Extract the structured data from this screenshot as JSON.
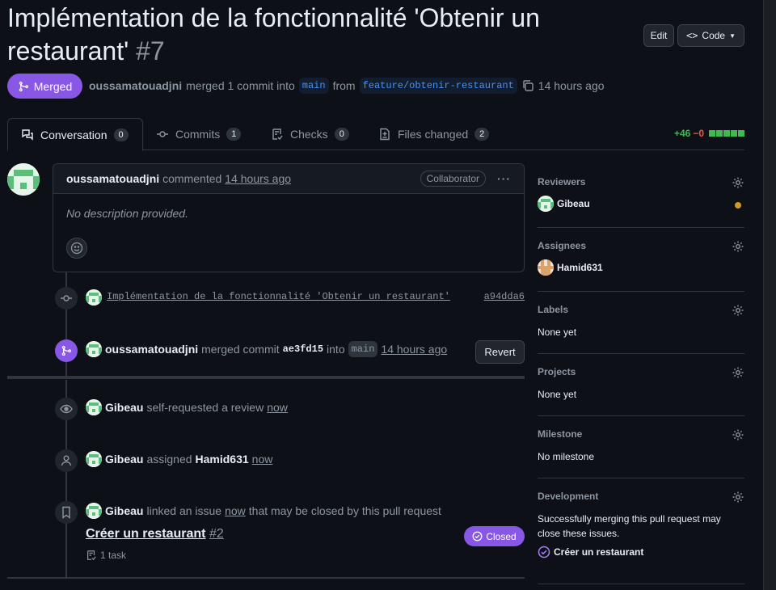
{
  "header": {
    "title": "Implémentation de la fonctionnalité 'Obtenir un restaurant'",
    "number": "#7",
    "edit_label": "Edit",
    "code_label": "Code"
  },
  "status": {
    "state_label": "Merged",
    "author": "oussamatouadjni",
    "merged_text": "merged 1 commit into",
    "base_branch": "main",
    "from_text": "from",
    "head_branch": "feature/obtenir-restaurant",
    "time": "14 hours ago"
  },
  "tabs": [
    {
      "label": "Conversation",
      "count": "0"
    },
    {
      "label": "Commits",
      "count": "1"
    },
    {
      "label": "Checks",
      "count": "0"
    },
    {
      "label": "Files changed",
      "count": "2"
    }
  ],
  "diffstat": {
    "additions": "+46",
    "deletions": "−0"
  },
  "comment": {
    "author": "oussamatouadjni",
    "action": "commented",
    "time": "14 hours ago",
    "role": "Collaborator",
    "body": "No description provided."
  },
  "commit_event": {
    "message": "Implémentation de la fonctionnalité 'Obtenir un restaurant'",
    "sha": "a94dda6"
  },
  "merge_event": {
    "author": "oussamatouadjni",
    "action": "merged commit",
    "sha": "ae3fd15",
    "into": "into",
    "branch": "main",
    "time": "14 hours ago",
    "revert_label": "Revert"
  },
  "review_event": {
    "user": "Gibeau",
    "text": "self-requested a review",
    "time": "now"
  },
  "assign_event": {
    "user": "Gibeau",
    "text": "assigned",
    "assignee": "Hamid631",
    "time": "now"
  },
  "link_event": {
    "user": "Gibeau",
    "text_pre": "linked an issue",
    "time": "now",
    "text_post": "that may be closed by this pull request",
    "issue_title": "Créer un restaurant",
    "issue_number": "#2",
    "issue_state": "Closed",
    "tasks": "1 task"
  },
  "sidebar": {
    "reviewers": {
      "title": "Reviewers",
      "name": "Gibeau"
    },
    "assignees": {
      "title": "Assignees",
      "name": "Hamid631"
    },
    "labels": {
      "title": "Labels",
      "value": "None yet"
    },
    "projects": {
      "title": "Projects",
      "value": "None yet"
    },
    "milestone": {
      "title": "Milestone",
      "value": "No milestone"
    },
    "development": {
      "title": "Development",
      "text": "Successfully merging this pull request may close these issues.",
      "issue": "Créer un restaurant"
    }
  },
  "colors": {
    "merged": "#8957e5",
    "added": "#3fb950",
    "deleted": "#f85149",
    "link": "#4493f8"
  }
}
